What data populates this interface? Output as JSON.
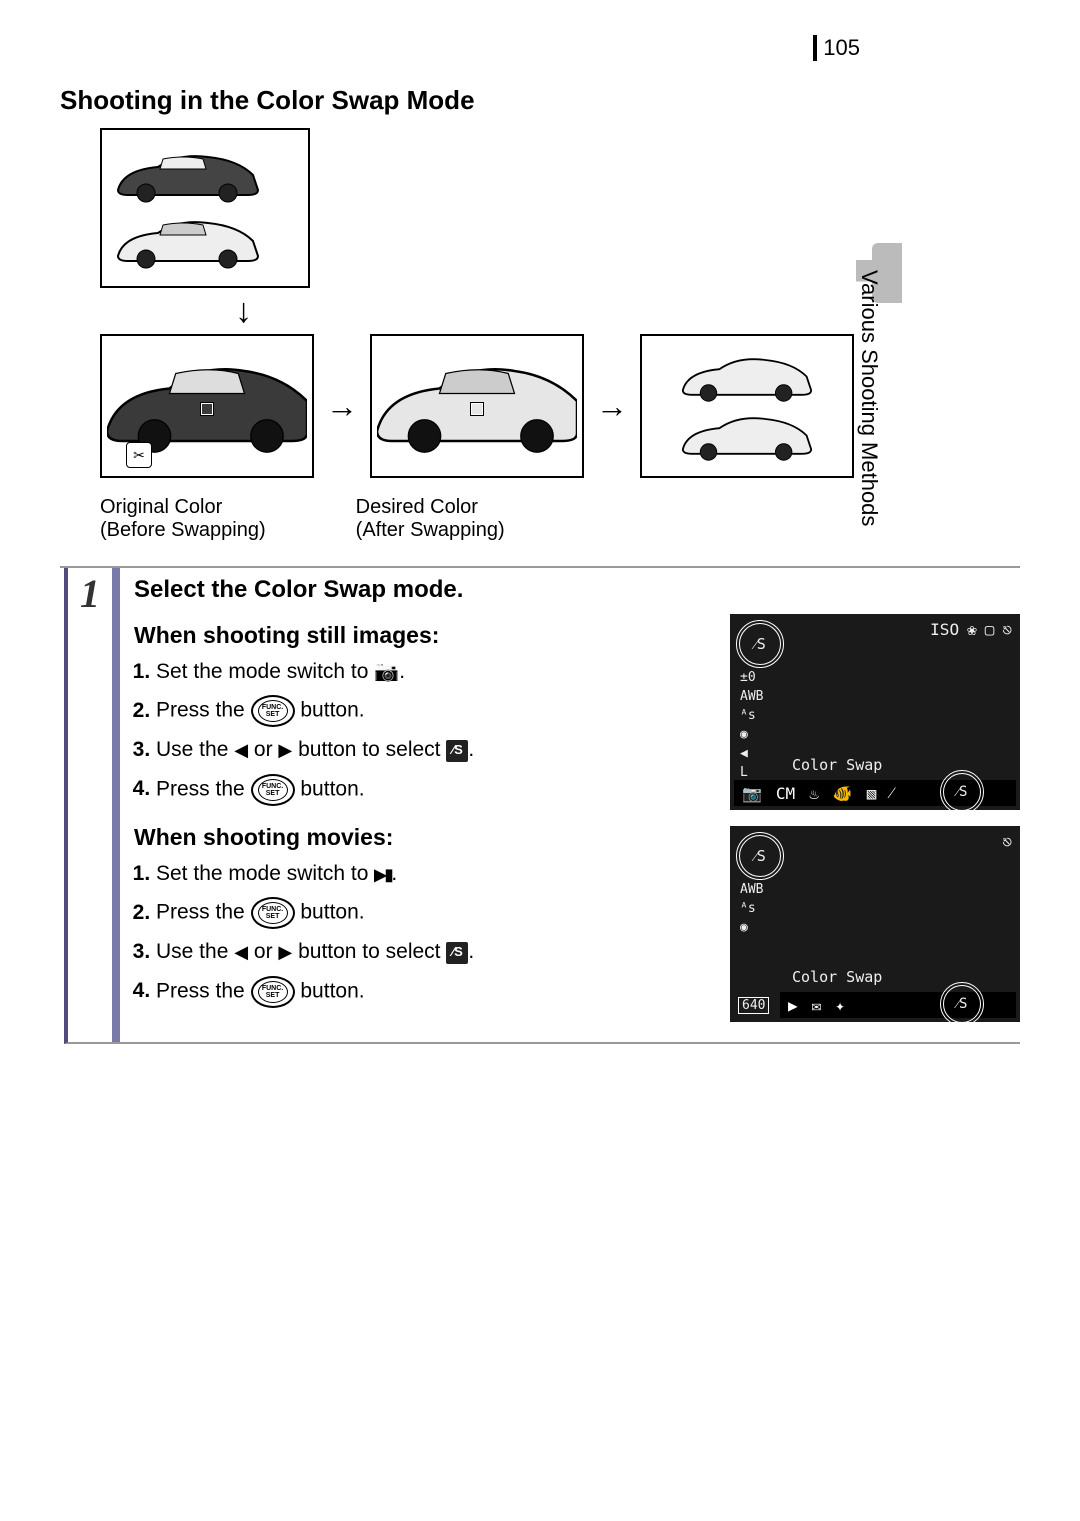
{
  "page_number": "105",
  "side_tab": "Various Shooting Methods",
  "heading": "Shooting in the Color Swap Mode",
  "captions": {
    "original": "Original Color\n(Before Swapping)",
    "desired": "Desired Color\n(After Swapping)"
  },
  "step": {
    "number": "1",
    "title": "Select the Color Swap mode.",
    "still": {
      "heading": "When shooting still images:",
      "items": {
        "s1a": "Set the mode switch to ",
        "s1b": ".",
        "s2a": "Press the ",
        "s2b": " button.",
        "s3a": "Use the ",
        "s3b": " or ",
        "s3c": " button to select ",
        "s3d": ".",
        "s4a": "Press the ",
        "s4b": " button."
      }
    },
    "movie": {
      "heading": "When shooting movies:",
      "items": {
        "m1a": "Set the mode switch to ",
        "m1b": ".",
        "m2a": "Press the ",
        "m2b": " button.",
        "m3a": "Use the ",
        "m3b": " or ",
        "m3c": " button to select ",
        "m3d": ".",
        "m4a": "Press the ",
        "m4b": " button."
      }
    }
  },
  "func_set": {
    "top": "FUNC.",
    "bottom": "SET"
  },
  "swap_icon_still": "⁄S",
  "swap_icon_movie": "⁄S",
  "screen": {
    "label": "Color Swap",
    "side": [
      "±0",
      "AWB",
      "ᴬs",
      "◉",
      "◀",
      "L"
    ],
    "top_icons_still": [
      "ISO",
      "❀",
      "▢",
      "⎋"
    ],
    "top_icons_movie": [
      "⎋"
    ],
    "bottom_still": [
      "📷",
      "CM",
      "♨",
      "🐠",
      "▧",
      "⁄"
    ],
    "bottom_movie": [
      "▶",
      "✉",
      "✦"
    ],
    "res": "640",
    "mode_icon_still": "⁄S",
    "mode_icon_movie": "⁄S"
  }
}
